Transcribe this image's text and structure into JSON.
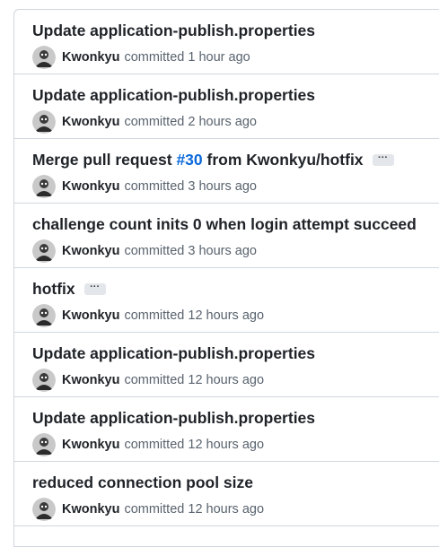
{
  "commits": [
    {
      "title": "Update application-publish.properties",
      "author": "Kwonkyu",
      "verb": "committed",
      "time": "1 hour ago",
      "has_ellipsis": false
    },
    {
      "title": "Update application-publish.properties",
      "author": "Kwonkyu",
      "verb": "committed",
      "time": "2 hours ago",
      "has_ellipsis": false
    },
    {
      "title_prefix": "Merge pull request ",
      "pr_link": "#30",
      "title_suffix": " from Kwonkyu/hotfix",
      "author": "Kwonkyu",
      "verb": "committed",
      "time": "3 hours ago",
      "has_ellipsis": true
    },
    {
      "title": "challenge count inits 0 when login attempt succeed",
      "author": "Kwonkyu",
      "verb": "committed",
      "time": "3 hours ago",
      "has_ellipsis": false
    },
    {
      "title": "hotfix",
      "author": "Kwonkyu",
      "verb": "committed",
      "time": "12 hours ago",
      "has_ellipsis": true
    },
    {
      "title": "Update application-publish.properties",
      "author": "Kwonkyu",
      "verb": "committed",
      "time": "12 hours ago",
      "has_ellipsis": false
    },
    {
      "title": "Update application-publish.properties",
      "author": "Kwonkyu",
      "verb": "committed",
      "time": "12 hours ago",
      "has_ellipsis": false
    },
    {
      "title": "reduced connection pool size",
      "author": "Kwonkyu",
      "verb": "committed",
      "time": "12 hours ago",
      "has_ellipsis": false
    }
  ],
  "ellipsis_label": "···",
  "colors": {
    "link": "#0969da",
    "border": "#d0d7de",
    "muted": "#59636e"
  },
  "icons": {
    "avatar": "user-avatar-icon"
  }
}
